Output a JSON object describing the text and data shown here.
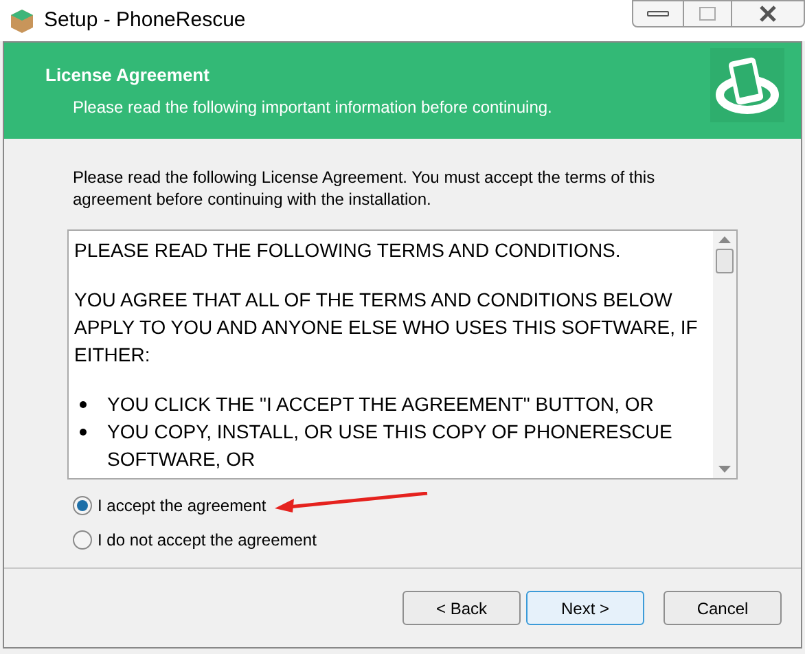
{
  "window": {
    "title": "Setup - PhoneRescue"
  },
  "header": {
    "title": "License Agreement",
    "subtitle": "Please read the following important information before continuing."
  },
  "instructions": "Please read the following License Agreement. You must accept the terms of this agreement before continuing with the installation.",
  "license": {
    "paragraphs": [
      {
        "kind": "text",
        "text": "PLEASE READ THE FOLLOWING TERMS AND CONDITIONS."
      },
      {
        "kind": "text",
        "text": "YOU AGREE THAT ALL OF THE TERMS AND CONDITIONS BELOW APPLY TO YOU AND ANYONE ELSE WHO USES THIS SOFTWARE, IF EITHER:"
      },
      {
        "kind": "bullet",
        "text": "YOU CLICK THE \"I ACCEPT THE AGREEMENT\" BUTTON, OR"
      },
      {
        "kind": "bullet",
        "text": "YOU COPY, INSTALL, OR USE THIS COPY OF PHONERESCUE SOFTWARE, OR"
      }
    ]
  },
  "options": [
    {
      "label": "I accept the agreement",
      "selected": true
    },
    {
      "label": "I do not accept the agreement",
      "selected": false
    }
  ],
  "buttons": [
    {
      "label": "< Back",
      "default": false
    },
    {
      "label": "Next >",
      "default": true
    },
    {
      "label": "Cancel",
      "default": false
    }
  ]
}
